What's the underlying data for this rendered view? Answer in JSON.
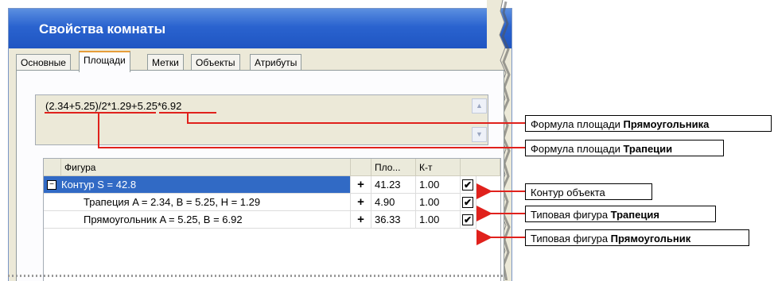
{
  "window": {
    "title": "Свойства комнаты"
  },
  "tabs": [
    {
      "label": "Основные"
    },
    {
      "label": "Площади"
    },
    {
      "label": "Метки"
    },
    {
      "label": "Объекты"
    },
    {
      "label": "Атрибуты"
    }
  ],
  "formula": {
    "text": "(2.34+5.25)/2*1.29+5.25*6.92"
  },
  "table": {
    "columns": [
      "Фигура",
      "Пло...",
      "К-т"
    ],
    "rows": [
      {
        "name": "Контур S = 42.8",
        "plus": "+",
        "area": "41.23",
        "coef": "1.00",
        "checked": "✔"
      },
      {
        "name": "Трапеция A = 2.34, B = 5.25, H = 1.29",
        "plus": "+",
        "area": "4.90",
        "coef": "1.00",
        "checked": "✔"
      },
      {
        "name": "Прямоугольник A = 5.25, B = 6.92",
        "plus": "+",
        "area": "36.33",
        "coef": "1.00",
        "checked": "✔"
      }
    ],
    "collapse_glyph": "−"
  },
  "callouts": {
    "rect_formula": {
      "pre": "Формула площади ",
      "bold": "Прямоугольника"
    },
    "trap_formula": {
      "pre": "Формула площади ",
      "bold": "Трапеции"
    },
    "contour": {
      "pre": "Контур объекта",
      "bold": ""
    },
    "trap_shape": {
      "pre": "Типовая фигура ",
      "bold": "Трапеция"
    },
    "rect_shape": {
      "pre": "Типовая фигура ",
      "bold": "Прямоугольник"
    }
  },
  "colors": {
    "accent": "#e0211c",
    "titlebar": "#2a63cf",
    "selection": "#316ac5"
  }
}
